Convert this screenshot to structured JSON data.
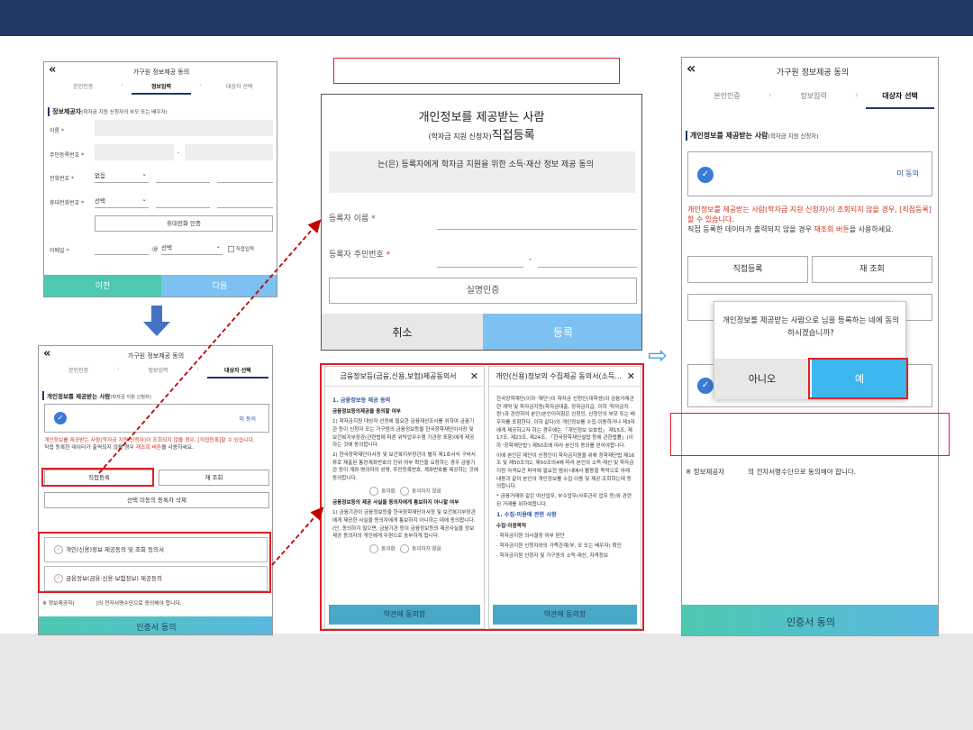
{
  "common": {
    "back_icon": "«",
    "header_title": "가구원 정보제공 동의",
    "step1": "본인인증",
    "step2": "정보입력",
    "step3": "대상자 선택",
    "chevron": "›"
  },
  "panel1": {
    "section": "정보제공자",
    "section_note": "(학자금 지원 신청자의 부모 또는 배우자)",
    "name_label": "이름 *",
    "rrn_label": "주민등록번호 *",
    "rrn_dash": "-",
    "phone_label": "전화번호 *",
    "phone_select": "없음",
    "mobile_label": "휴대전화번호 *",
    "mobile_select": "선택",
    "verify_button": "휴대전화 인증",
    "email_label": "이메일 *",
    "email_at": "@",
    "email_select": "선택",
    "direct_input": "직접입력",
    "prev_button": "이전",
    "next_button": "다음"
  },
  "panel2": {
    "section": "개인정보를 제공받는 사람",
    "section_note": "(학자금 지원 신청자)",
    "unmatched": "미 동의",
    "red_note": "개인정보를 제공받는 사람(학자금 지원 신청자)이 조회되지 않을 경우, [직접등록]할 수 있습니다.",
    "black_note_a": "직접 등록한 데이터가 출력되지 않을 경우 ",
    "black_note_red": "재조회 버튼",
    "black_note_b": "을 사용하세요.",
    "direct_register": "직접등록",
    "rescan": "재 조회",
    "delete_unselected": "선택 미동의 등록자 삭제",
    "agree1": "개인(신용)정보 제공동의 및 조회 동의서",
    "agree2": "금융정보(금융·신용·보험정보) 제공동의",
    "provider_note_a": "※ 정보제공자(",
    "provider_note_b": ")의 전자서명수단으로 동의해야 합니다.",
    "cert_button": "인증서 동의"
  },
  "register": {
    "title1": "개인정보를 제공받는 사람",
    "title2_small": "(학자금 지원 신청자)",
    "title2_big": "직접등록",
    "grey_text": "는(은) 등록자에게 학자금 지원을 위한 소득·재산 정보 제공 동의",
    "name_label": "등록자 이름",
    "rrn_label": "등록자 주민번호",
    "star": "*",
    "dash": "-",
    "verify_button": "실명인증",
    "cancel_button": "취소",
    "register_button": "등록"
  },
  "doc1": {
    "title": "금융정보등(금융,신용,보험)제공동의서",
    "close": "✕",
    "h1": "1. 금융정보등 제공 동의",
    "b1": "금융정보등의제공을 동의할 여부",
    "p1": "1) 학자금지원 대상자 선정에 필요한 금융재산조사를 위하여 금융기관 등이 신청자 또는 가구원의 금융정보등을 한국장학재단이사장 및 보건복지부장관(관련법에 따른 위탁업무수행 기관장 포함)에게 제공하는 것에 동의합니다.",
    "p2": "2) 한국장학재단이사장 및 보건복지부장관이 별지 제1호서식 구비서류로 제출된 통장계좌번호의 진위 여부 확인을 요청하는 경우 금융기관 등이 계좌·명의자의 성명, 주민등록번호, 계좌번호를 제공하는 것에 동의합니다.",
    "agree": "동의함",
    "disagree": "동의하지 않음",
    "b2": "금융정보등의 제공 사실을 동의자에게 통보하지 아니할 여부",
    "p3": "1) 금융기관이 금융정보등을 한국장학재단이사장 및 보건복지부장관에게 제공한 사실을 동의자에게 통보하지 아니하는 데에 동의합니다.(단, 동의하지 않으면, 금융기관 등이 금융정보등의 제공사실을 정보제공 동의자의 개인에게 우편으로 송부하게 됩니다.",
    "button": "약관에 동의함"
  },
  "doc2": {
    "title": "개인(신용)정보의 수집제공 동의서(소득...",
    "close": "✕",
    "p1": "한국장학재단(이하 '재단')이 학자금 신청인(대학생)의 금융거래관련 계약 및 학자금지원(학자금대출, 장학금지급, 이하 '학자금지원')과 관련하여 본인(본인이라함은 신청인, 신청인의 부모 또는 배우자를 포함한다. 이하 같다)의 개인정보를 수집·이용하거나 제3자에게 제공하고자 하는 경우에는 「개인정보 보호법」 제15조, 제17조, 제23조, 제24조, 「한국장학재단설립 등에 관한법률」(이하 '장학재단법') 제50조에 따라 본인의 동의를 얻어야합니다.",
    "p2": "이에 본인은 재단이 신청인이 학자금지원을 위해 장학재단법 제16조 및 제50조의2, 제50조의4에 따라 본인의 소득·재산 및 학자금지원 자격요건 파악에 필요한 범위 내에서 활용할 목적으로 아래 내용과 같이 본인의 개인정보를 수집·이용 및 제공·조회하는데 동의합니다.",
    "p3": "* 금융거래와 같은 여신업무, 부수업무(사후관리 업무 등)와 관련된 거래를 위하여합니다.",
    "h1": "1. 수집·이용에 관한 사항",
    "b1": "수집·이용목적",
    "l1": "· 학자금지원 의사결정 여부 판단",
    "l2": "· 학자금지원 신청자와의 가족관계(부, 모 또는 배우자) 확인",
    "l3": "· 학자금지원 신청자 및 가구원의 소득·재산, 자격정보",
    "button": "약관에 동의함"
  },
  "panel3": {
    "modal_text": "개인정보를 제공받는 사람으로            님을 등록하는 네에 동의 하시겠습니까?",
    "no_button": "아니오",
    "yes_button": "예",
    "provider_note_a": "※ 정보제공자",
    "provider_note_b": "의 전자서명수단으로 동의해야 합니다."
  },
  "nav": {
    "right_arrow_icon": "⇨"
  },
  "colors": {
    "topbar": "#1f3864",
    "teal": "#4cc9b0",
    "blue_button": "#7dc0f2",
    "highlight": "#e01f26",
    "sky": "#3db8ee"
  }
}
